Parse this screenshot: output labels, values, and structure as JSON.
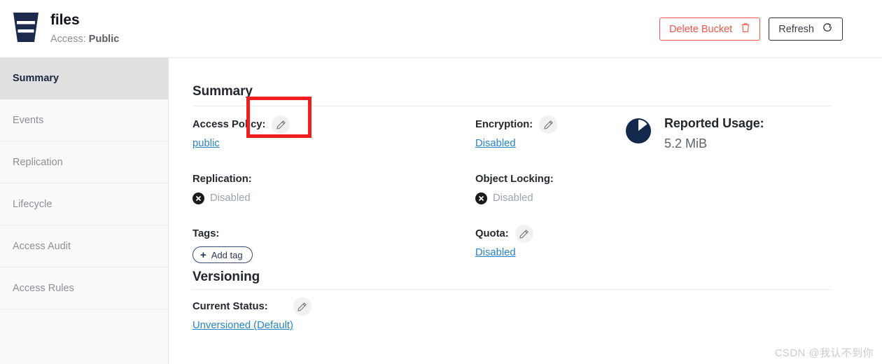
{
  "header": {
    "bucket_icon": "bucket-icon",
    "bucket_name": "files",
    "access_label": "Access:",
    "access_value": "Public",
    "delete_button": "Delete Bucket",
    "delete_icon": "trash-icon",
    "refresh_button": "Refresh",
    "refresh_icon": "refresh-icon"
  },
  "sidebar": {
    "items": [
      {
        "label": "Summary",
        "active": true
      },
      {
        "label": "Events",
        "active": false
      },
      {
        "label": "Replication",
        "active": false
      },
      {
        "label": "Lifecycle",
        "active": false
      },
      {
        "label": "Access Audit",
        "active": false
      },
      {
        "label": "Access Rules",
        "active": false
      }
    ]
  },
  "main": {
    "summary_title": "Summary",
    "versioning_title": "Versioning",
    "fields": {
      "access_policy": {
        "label": "Access Policy:",
        "value": "public",
        "edit_icon": "pencil-icon"
      },
      "replication": {
        "label": "Replication:",
        "value": "Disabled",
        "status_icon": "x-circle-icon"
      },
      "tags": {
        "label": "Tags:",
        "add_tag_button": "Add tag",
        "add_icon": "plus-icon"
      },
      "encryption": {
        "label": "Encryption:",
        "value": "Disabled",
        "edit_icon": "pencil-icon"
      },
      "object_locking": {
        "label": "Object Locking:",
        "value": "Disabled",
        "status_icon": "x-circle-icon"
      },
      "quota": {
        "label": "Quota:",
        "value": "Disabled",
        "edit_icon": "pencil-icon"
      },
      "current_status": {
        "label": "Current Status:",
        "value": "Unversioned (Default)",
        "edit_icon": "pencil-icon"
      }
    },
    "usage": {
      "icon": "pie-chart-icon",
      "title": "Reported Usage:",
      "value": "5.2 MiB"
    }
  },
  "annotation": {
    "type": "highlight-rectangle",
    "color": "#f01e1e",
    "target": "access-policy-edit-icon"
  },
  "watermark": "CSDN @我认不到你",
  "colors": {
    "brand_navy": "#1c2a4e",
    "danger": "#f1554c",
    "link": "#2884c4",
    "muted": "#9aa4b0",
    "sidebar_bg": "#fafafa",
    "sidebar_active_bg": "#e0e0e0"
  }
}
